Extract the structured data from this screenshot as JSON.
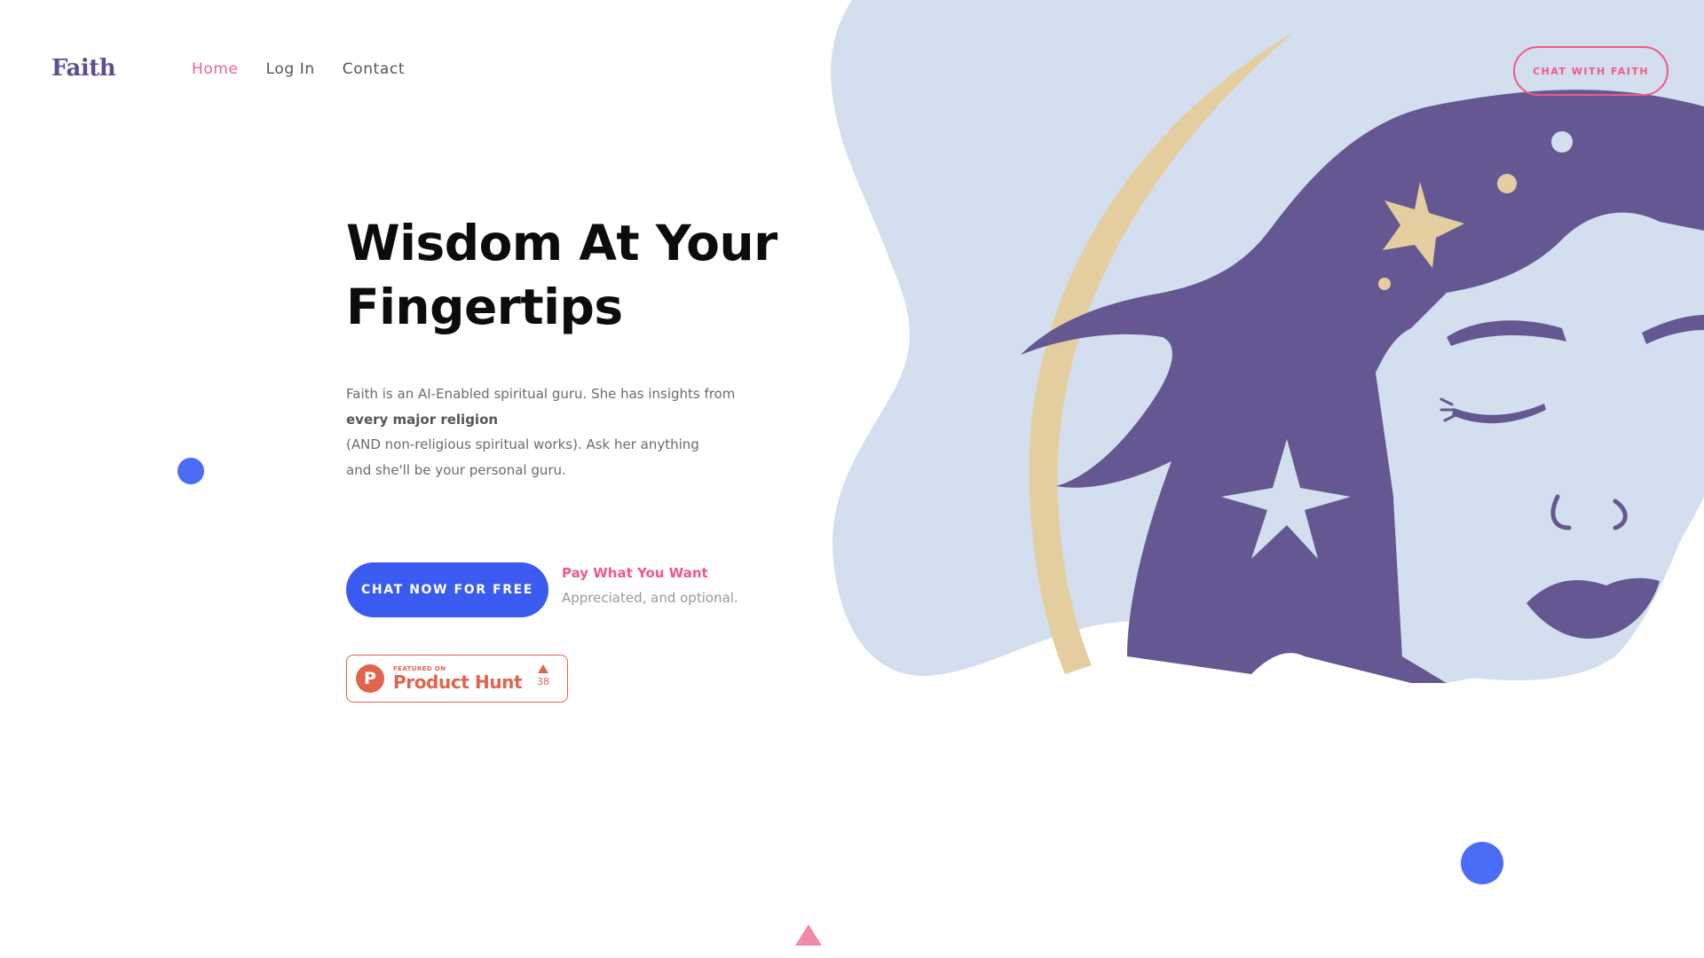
{
  "brand": {
    "logo": "Faith"
  },
  "nav": {
    "items": [
      "Home",
      "Log In",
      "Contact"
    ],
    "active": "Home"
  },
  "header": {
    "cta_label": "CHAT WITH FAITH"
  },
  "hero": {
    "title_line1": "Wisdom At Your",
    "title_line2": "Fingertips",
    "desc_line1": "Faith is an AI-Enabled spiritual guru. She has insights from",
    "desc_line2": "every major religion",
    "desc_line3": "(AND non-religious spiritual works). Ask her anything",
    "desc_line4": "and she'll be your personal guru.",
    "cta_primary": "CHAT NOW FOR FREE",
    "pay_title": "Pay What You Want",
    "pay_sub": "Appreciated, and optional."
  },
  "product_hunt": {
    "featured_label": "FEATURED ON",
    "name": "Product Hunt",
    "votes": "38",
    "logo_letter": "P"
  },
  "colors": {
    "accent_pink": "#ee5a86",
    "primary_blue": "#3b5bf0",
    "brand_purple": "#5b4f93",
    "art_bg": "#d3dfee",
    "moon_gold": "#e4ce9f",
    "hair_purple": "#655892"
  },
  "icons": [
    "product-hunt-logo-icon",
    "upvote-arrow-icon",
    "decorative-dot",
    "decorative-triangle"
  ]
}
